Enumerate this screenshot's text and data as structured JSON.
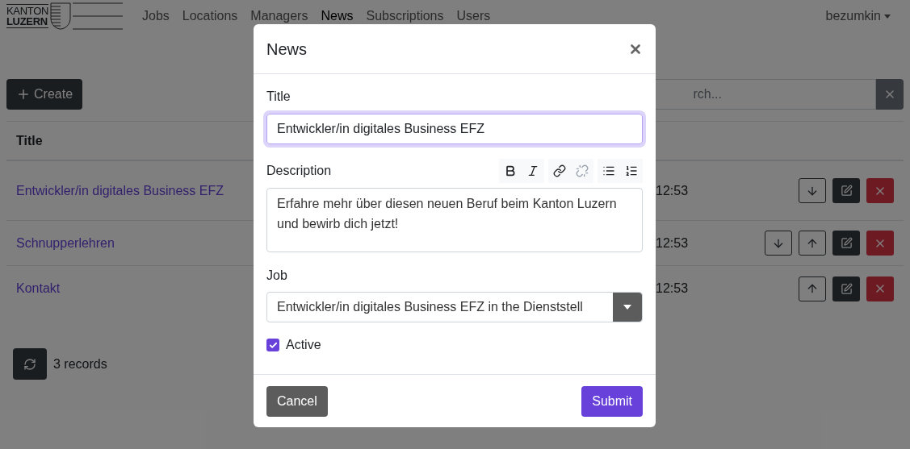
{
  "nav": {
    "logo": {
      "line1": "KANTON",
      "line2": "LUZERN"
    },
    "items": [
      {
        "label": "Jobs",
        "selected": false
      },
      {
        "label": "Locations",
        "selected": false
      },
      {
        "label": "Managers",
        "selected": false
      },
      {
        "label": "News",
        "selected": true
      },
      {
        "label": "Subscriptions",
        "selected": false
      },
      {
        "label": "Users",
        "selected": false
      }
    ],
    "user": "bezumkin"
  },
  "toolbar": {
    "create": "Create",
    "search_placeholder": "rch..."
  },
  "table": {
    "columns": [
      "Title"
    ],
    "rows": [
      {
        "title": "Entwickler/in digitales Business EFZ",
        "time": "12:53",
        "actions": [
          {
            "kind": "down"
          },
          {
            "kind": "edit"
          },
          {
            "kind": "delete"
          }
        ]
      },
      {
        "title": "Schnupperlehren",
        "time": "12:53",
        "actions": [
          {
            "kind": "down"
          },
          {
            "kind": "up"
          },
          {
            "kind": "edit"
          },
          {
            "kind": "delete"
          }
        ]
      },
      {
        "title": "Kontakt",
        "time": "12:53",
        "actions": [
          {
            "kind": "up"
          },
          {
            "kind": "edit"
          },
          {
            "kind": "delete"
          }
        ]
      }
    ]
  },
  "footer": {
    "records": "3 records"
  },
  "modal": {
    "title": "News",
    "title_label": "Title",
    "title_value": "Entwickler/in digitales Business EFZ",
    "description_label": "Description",
    "editor_tools": [
      [
        {
          "kind": "bold"
        },
        {
          "kind": "italic"
        }
      ],
      [
        {
          "kind": "link"
        },
        {
          "kind": "unlink"
        }
      ],
      [
        {
          "kind": "bullet-list"
        },
        {
          "kind": "numbered-list"
        }
      ]
    ],
    "description_value": "Erfahre mehr über diesen neuen Beruf beim Kanton Luzern und bewirb dich jetzt!",
    "job_label": "Job",
    "job_value": "Entwickler/in digitales Business EFZ in the Dienststell",
    "active": {
      "label": "Active",
      "checked": true
    },
    "cancel": "Cancel",
    "submit": "Submit"
  }
}
